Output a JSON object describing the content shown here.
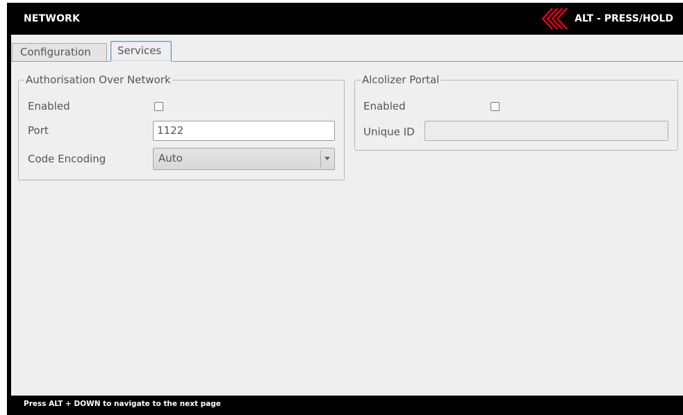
{
  "header": {
    "title": "NETWORK",
    "alt_label": "ALT - PRESS/HOLD",
    "accent_color": "#e3001b"
  },
  "tabs": [
    {
      "label": "Configuration",
      "active": false
    },
    {
      "label": "Services",
      "active": true
    }
  ],
  "authorisation": {
    "legend": "Authorisation Over Network",
    "enabled_label": "Enabled",
    "enabled_checked": false,
    "port_label": "Port",
    "port_value": "1122",
    "encoding_label": "Code Encoding",
    "encoding_value": "Auto"
  },
  "portal": {
    "legend": "Alcolizer Portal",
    "enabled_label": "Enabled",
    "enabled_checked": false,
    "unique_id_label": "Unique ID",
    "unique_id_value": ""
  },
  "footer": {
    "hint": "Press ALT + DOWN to navigate to the next page"
  }
}
